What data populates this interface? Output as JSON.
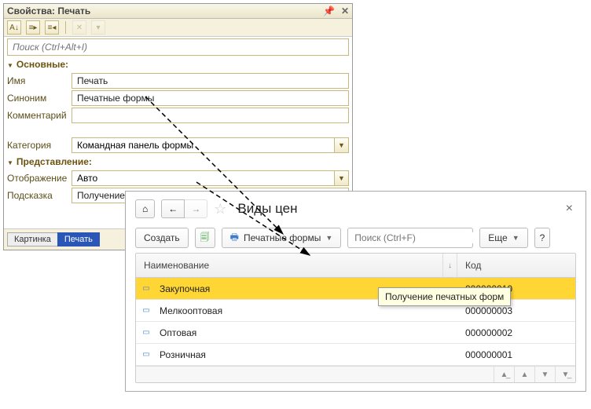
{
  "props": {
    "title": "Свойства: Печать",
    "search_placeholder": "Поиск (Ctrl+Alt+I)",
    "section_basic": "Основные:",
    "section_present": "Представление:",
    "labels": {
      "name": "Имя",
      "synonym": "Синоним",
      "comment": "Комментарий",
      "category": "Категория",
      "display": "Отображение",
      "hint": "Подсказка"
    },
    "values": {
      "name": "Печать",
      "synonym": "Печатные формы",
      "comment": "",
      "category": "Командная панель формы",
      "display": "Авто",
      "hint": "Получение печатных форм"
    },
    "footer_tabs": [
      "Картинка",
      "Печать"
    ]
  },
  "form": {
    "title": "Виды цен",
    "create": "Создать",
    "print_label": "Печатные формы",
    "search_placeholder": "Поиск (Ctrl+F)",
    "more": "Еще",
    "help": "?",
    "tooltip": "Получение печатных форм",
    "columns": {
      "name": "Наименование",
      "code": "Код"
    },
    "rows": [
      {
        "name": "Закупочная",
        "code": "000000010",
        "selected": true
      },
      {
        "name": "Мелкооптовая",
        "code": "000000003",
        "selected": false
      },
      {
        "name": "Оптовая",
        "code": "000000002",
        "selected": false
      },
      {
        "name": "Розничная",
        "code": "000000001",
        "selected": false
      }
    ]
  }
}
